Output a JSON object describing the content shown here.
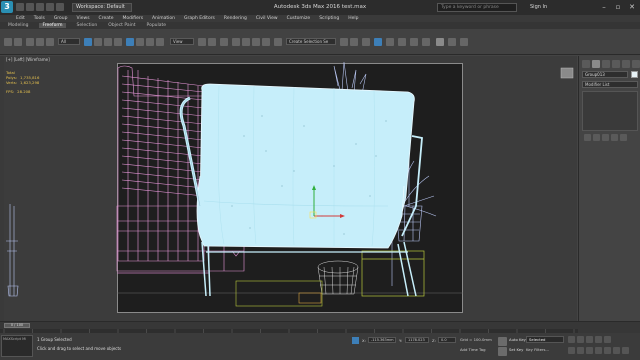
{
  "titlebar": {
    "logo": "3",
    "workspace": "Workspace: Default",
    "title": "Autodesk 3ds Max 2016    test.max",
    "search_placeholder": "Type a keyword or phrase",
    "signin": "Sign In"
  },
  "menu": [
    "Edit",
    "Tools",
    "Group",
    "Views",
    "Create",
    "Modifiers",
    "Animation",
    "Graph Editors",
    "Rendering",
    "Civil View",
    "Customize",
    "Scripting",
    "Help"
  ],
  "ribbon": {
    "tabs": [
      "Modeling",
      "Freeform",
      "Selection",
      "Object Paint",
      "Populate"
    ],
    "active": "Freeform"
  },
  "toolbar": {
    "selection_filter": "All",
    "coord_system": "View",
    "named_selection": "Create Selection Se"
  },
  "viewport": {
    "label": "[+] [Left] [Wireframe]",
    "stats_header": "Total",
    "polys_label": "Polys:",
    "polys_value": "1,735,816",
    "verts_label": "Verts:",
    "verts_value": "1,623,298",
    "fps_label": "FPS:",
    "fps_value": "28.208"
  },
  "command_panel": {
    "object_name": "Group013",
    "modifier_list": "Modifier List"
  },
  "timeline": {
    "frame_display": "0 / 100",
    "ticks": [
      "0",
      "5",
      "10",
      "15",
      "20",
      "25",
      "30",
      "35",
      "40",
      "45",
      "50",
      "55",
      "60",
      "65",
      "70",
      "75",
      "80",
      "85",
      "90",
      "95",
      "100"
    ]
  },
  "statusbar": {
    "maxscript_label": "MAXScript Mi",
    "selection_status": "1 Group Selected",
    "prompt": "Click and drag to select and move objects",
    "x_label": "X:",
    "x_value": "-115.363mm",
    "y_label": "Y:",
    "y_value": "1178.023",
    "z_label": "Z:",
    "z_value": "0.0",
    "grid": "Grid = 100.0mm",
    "add_time_tag": "Add Time Tag",
    "auto_key": "Auto Key",
    "set_key": "Set Key",
    "selected": "Selected",
    "key_filters": "Key Filters..."
  },
  "colors": {
    "chair_wire": "#c6eefa",
    "sofa_wire": "#e696d8",
    "plant_wire": "#b8c6f2",
    "table_wire": "#b9c93d",
    "viewport_bg": "#1e1e1e",
    "accent": "#3d7fb8"
  }
}
